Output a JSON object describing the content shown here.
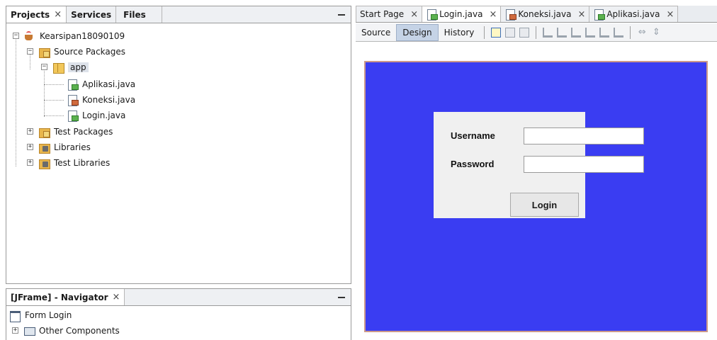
{
  "projects_panel": {
    "tabs": [
      {
        "label": "Projects",
        "close": "×"
      },
      {
        "label": "Services"
      },
      {
        "label": "Files"
      }
    ],
    "tree": {
      "project": "Kearsipan18090109",
      "source_packages": "Source Packages",
      "package": "app",
      "files": [
        "Aplikasi.java",
        "Koneksi.java",
        "Login.java"
      ],
      "test_packages": "Test Packages",
      "libraries": "Libraries",
      "test_libraries": "Test Libraries"
    }
  },
  "navigator_panel": {
    "title": "[JFrame] - Navigator",
    "close": "×",
    "items": [
      "Form Login",
      "Other Components"
    ]
  },
  "editor": {
    "tabs": [
      {
        "label": "Start Page",
        "close": "×"
      },
      {
        "label": "Login.java",
        "close": "×",
        "active": true
      },
      {
        "label": "Koneksi.java",
        "close": "×"
      },
      {
        "label": "Aplikasi.java",
        "close": "×"
      }
    ],
    "toolbar": {
      "source": "Source",
      "design": "Design",
      "history": "History"
    },
    "form": {
      "username_label": "Username",
      "password_label": "Password",
      "login_button": "Login",
      "username_value": "",
      "password_value": ""
    },
    "colors": {
      "canvas_background": "#3a3df2",
      "panel_background": "#f0f0f0"
    }
  }
}
